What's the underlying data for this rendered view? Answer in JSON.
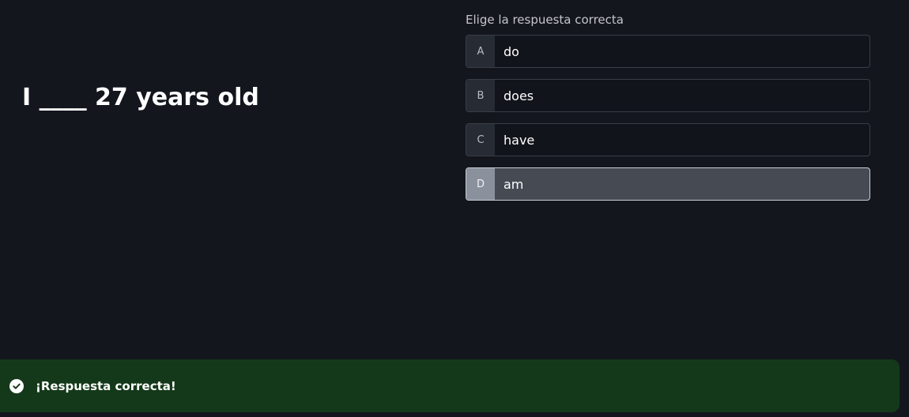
{
  "question": {
    "text": "I ____ 27 years old"
  },
  "instructions": "Elige la respuesta correcta",
  "options": [
    {
      "letter": "A",
      "text": "do"
    },
    {
      "letter": "B",
      "text": "does"
    },
    {
      "letter": "C",
      "text": "have"
    },
    {
      "letter": "D",
      "text": "am"
    }
  ],
  "selected_option": "D",
  "feedback": {
    "message": "¡Respuesta correcta!",
    "icon": "check-circle-icon",
    "background": "#14391a"
  },
  "colors": {
    "page_background": "#14161e",
    "option_background": "#12141b",
    "selected_background": "#454a53"
  }
}
